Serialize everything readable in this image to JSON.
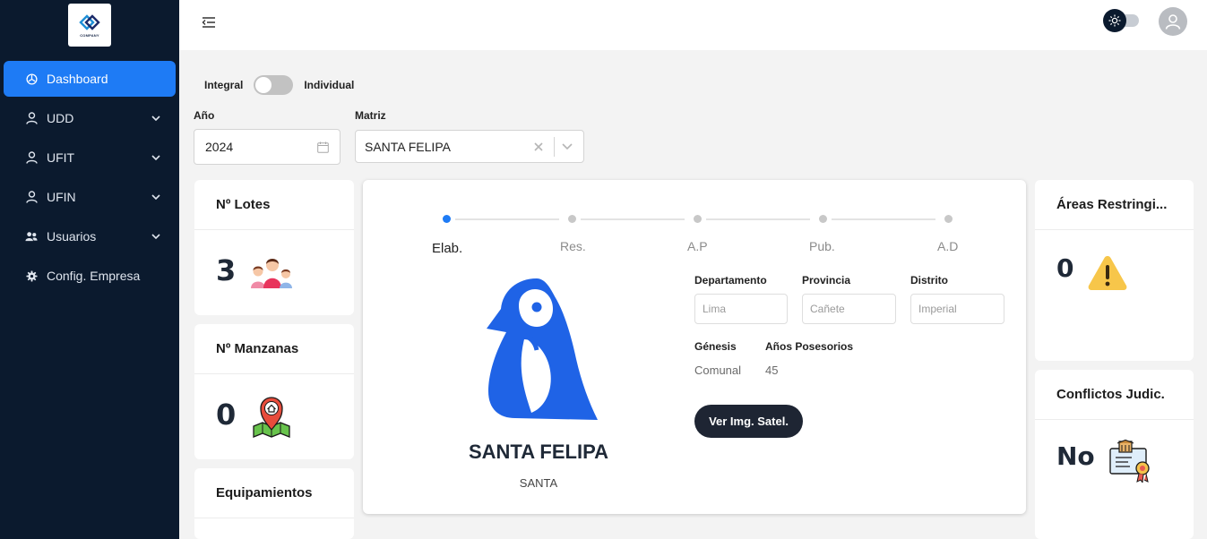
{
  "brand": {
    "logo_text": "COMPANY"
  },
  "sidebar": {
    "items": [
      {
        "label": "Dashboard",
        "icon": "dashboard-icon",
        "active": true,
        "has_submenu": false
      },
      {
        "label": "UDD",
        "icon": "user-icon",
        "active": false,
        "has_submenu": true
      },
      {
        "label": "UFIT",
        "icon": "user-icon",
        "active": false,
        "has_submenu": true
      },
      {
        "label": "UFIN",
        "icon": "user-icon",
        "active": false,
        "has_submenu": true
      },
      {
        "label": "Usuarios",
        "icon": "users-icon",
        "active": false,
        "has_submenu": true
      },
      {
        "label": "Config. Empresa",
        "icon": "gear-icon",
        "active": false,
        "has_submenu": false
      }
    ]
  },
  "filters": {
    "mode_left": "Integral",
    "mode_right": "Individual",
    "year_label": "Año",
    "year_value": "2024",
    "matriz_label": "Matriz",
    "matriz_value": "SANTA FELIPA"
  },
  "cards": {
    "lotes": {
      "title": "Nº Lotes",
      "value": "3"
    },
    "manzanas": {
      "title": "Nº Manzanas",
      "value": "0"
    },
    "equipamientos": {
      "title": "Equipamientos"
    },
    "areas": {
      "title": "Áreas Restringi...",
      "value": "0"
    },
    "conflictos": {
      "title": "Conflictos Judic.",
      "value": "No"
    }
  },
  "steps": [
    "Elab.",
    "Res.",
    "A.P",
    "Pub.",
    "A.D"
  ],
  "detail": {
    "name": "SANTA FELIPA",
    "subname": "SANTA",
    "departamento_label": "Departamento",
    "departamento_value": "Lima",
    "provincia_label": "Provincia",
    "provincia_value": "Cañete",
    "distrito_label": "Distrito",
    "distrito_value": "Imperial",
    "genesis_label": "Génesis",
    "genesis_value": "Comunal",
    "anios_label": "Años Posesorios",
    "anios_value": "45",
    "button_label": "Ver Img. Satel."
  },
  "colors": {
    "sidebar": "#0b1a2e",
    "accent": "#1e7bf5",
    "button_dark": "#1e2533",
    "warning": "#f5c242"
  }
}
